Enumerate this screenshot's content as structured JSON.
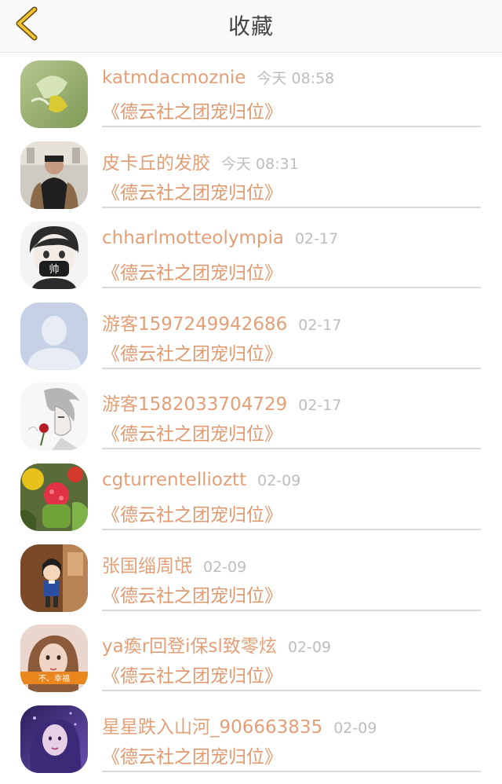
{
  "header": {
    "title": "收藏",
    "back_icon": "chevron-left-icon",
    "accent_color": "#f2c233"
  },
  "colors": {
    "username": "#e3a078",
    "work_title": "#e0996f",
    "time": "#bdbdbd"
  },
  "favorites": [
    {
      "username": "katmdacmoznie",
      "time": "今天 08:58",
      "work": "《德云社之团宠归位》",
      "avatar": "leaf-photo-avatar"
    },
    {
      "username": "皮卡丘的发胶",
      "time": "今天 08:31",
      "work": "《德云社之团宠归位》",
      "avatar": "man-photo-avatar"
    },
    {
      "username": "chharlmotteolympia",
      "time": "02-17",
      "work": "《德云社之团宠归位》",
      "avatar": "cartoon-boy-avatar"
    },
    {
      "username": "游客1597249942686",
      "time": "02-17",
      "work": "《德云社之团宠归位》",
      "avatar": "default-user-avatar"
    },
    {
      "username": "游客1582033704729",
      "time": "02-17",
      "work": "《德云社之团宠归位》",
      "avatar": "anime-sketch-avatar"
    },
    {
      "username": "cgturrentellioztt",
      "time": "02-09",
      "work": "《德云社之团宠归位》",
      "avatar": "cactus-photo-avatar"
    },
    {
      "username": "张国缁周氓",
      "time": "02-09",
      "work": "《德云社之团宠归位》",
      "avatar": "cartoon-detective-avatar"
    },
    {
      "username": "ya瘓r回登i保sl致零炫",
      "time": "02-09",
      "work": "《德云社之团宠归位》",
      "avatar": "girl-photo-avatar",
      "avatar_caption": "不、幸福"
    },
    {
      "username": "星星跌入山河_906663835",
      "time": "02-09",
      "work": "《德云社之团宠归位》",
      "avatar": "purple-portrait-avatar"
    }
  ]
}
